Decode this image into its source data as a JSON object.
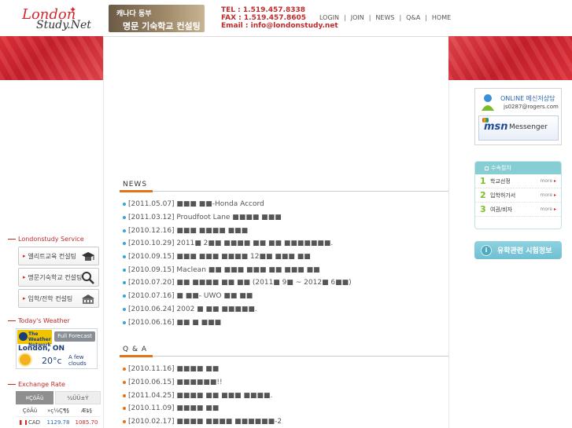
{
  "header": {
    "logo_line1": "London",
    "logo_line2": "Study.Net",
    "banner_line1": "캐나다 동부",
    "banner_line2": "명문 기숙학교 컨설팅",
    "tel": "TEL : 1.519.457.8338",
    "fax": "FAX : 1.519.457.8605",
    "email": "Email : info@londonstudy.net",
    "nav": [
      "LOGIN",
      "JOIN",
      "NEWS",
      "Q&A",
      "HOME"
    ]
  },
  "left": {
    "service_title": "Londonstudy Service",
    "services": [
      "엘리트교육 컨설팅",
      "명문기숙학교 컨설팅",
      "입학/전학 컨설팅"
    ],
    "weather_title": "Today's Weather",
    "weather": {
      "provider": "The Weather Network",
      "forecast_btn": "Full Forecast",
      "city": "London, ON",
      "temp": "20°c",
      "condition": "A few clouds"
    },
    "exchange_title": "Exchange Rate",
    "exchange_tabs": [
      "¤ÇöÂü",
      "¼ÛÜ±Ý"
    ],
    "exchange_header": [
      "ÇöÂü",
      "»ç½Ç¶§",
      "Æȶ§"
    ],
    "exchange_rows": [
      {
        "currency": "CAD",
        "buy": "1129.78",
        "sell": "1085.70"
      }
    ]
  },
  "news": {
    "title": "NEWS",
    "items": [
      "[2011.05.07] ■■■ ■■-Honda Accord",
      "[2011.03.12] Proudfoot Lane ■■■■ ■■■",
      "[2010.12.16] ■■■ ■■■■ ■■■",
      "[2010.10.29] 2011■ 2■■ ■■■■ ■■ ■■ ■■■■■■■.",
      "[2010.09.15] ■■■ ■■■ ■■■■ 12■■ ■■■ ■■",
      "[2010.09.15] Maclean ■■ ■■■ ■■■ ■■ ■■■ ■■",
      "[2010.07.20] ■■ ■■■■ ■■ ■■ (2011■ 9■ ~ 2012■ 6■■)",
      "[2010.07.16] ■ ■■- UWO ■■ ■■",
      "[2010.06.24] 2002 ■ ■■ ■■■■■.",
      "[2010.06.16] ■■ ■ ■■■"
    ]
  },
  "qa": {
    "title": "Q & A",
    "items": [
      "[2010.11.16] ■■■■ ■■",
      "[2010.06.15] ■■■■■■!!",
      "[2011.04.25] ■■■■ ■■ ■■■ ■■■■.",
      "[2010.11.09] ■■■■ ■■",
      "[2010.02.17] ■■■■ ■■■■ ■■■■■■-2"
    ]
  },
  "right": {
    "online_title": "ONLINE 메신저상담",
    "online_email": "js0287@rogers.com",
    "msn_brand": "msn",
    "msn_label": "Messenger",
    "proc_title": "수속절차",
    "proc_items": [
      {
        "num": "1",
        "label": "학교선정",
        "more": "more"
      },
      {
        "num": "2",
        "label": "입학허가서",
        "more": "more"
      },
      {
        "num": "3",
        "label": "여권/비자",
        "more": "more"
      }
    ],
    "exam_label": "유학관련 시험정보"
  },
  "colors": {
    "accent_red": "#d8262d",
    "news_bullet": "#3aa3d4",
    "qa_bullet": "#e1731b",
    "proc_header": "#86cdd4"
  }
}
